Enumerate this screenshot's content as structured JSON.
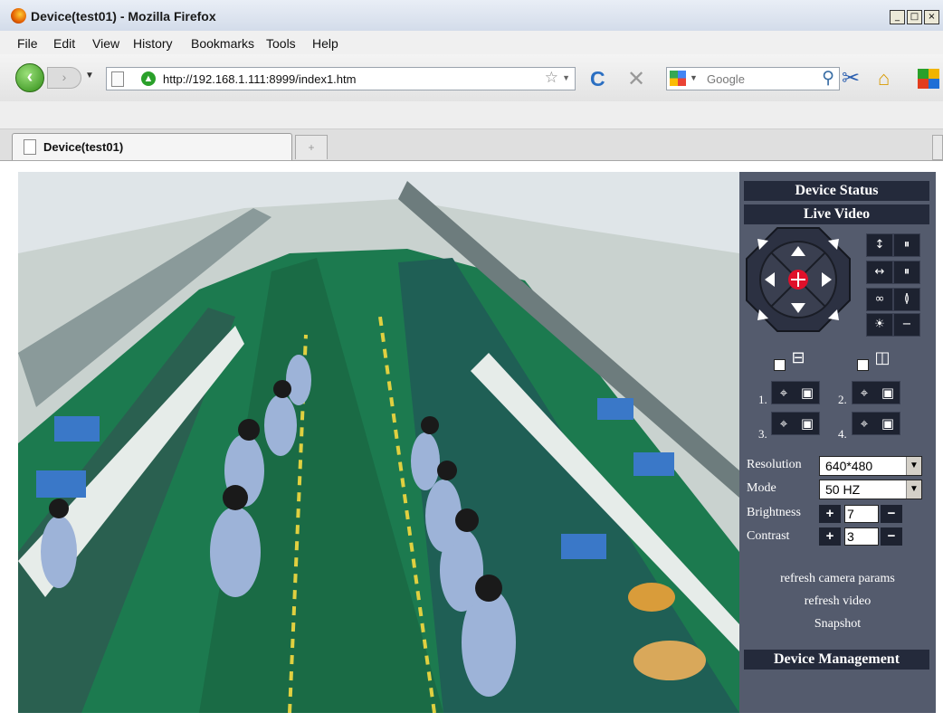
{
  "window": {
    "title": "Device(test01) - Mozilla Firefox",
    "controls": [
      "_",
      "□",
      "×"
    ]
  },
  "menu": [
    "File",
    "Edit",
    "View",
    "History",
    "Bookmarks",
    "Tools",
    "Help"
  ],
  "nav": {
    "url": "http://192.168.1.111:8999/index1.htm",
    "search_placeholder": "Google"
  },
  "tab": {
    "label": "Device(test01)"
  },
  "panel": {
    "device_status": "Device Status",
    "live_video": "Live Video",
    "preset_numbers": [
      "1.",
      "2.",
      "3.",
      "4."
    ],
    "resolution_label": "Resolution",
    "resolution_value": "640*480",
    "mode_label": "Mode",
    "mode_value": "50 HZ",
    "brightness_label": "Brightness",
    "brightness_value": "7",
    "contrast_label": "Contrast",
    "contrast_value": "3",
    "refresh_params": "refresh camera params",
    "refresh_video": "refresh video",
    "snapshot": "Snapshot",
    "device_management": "Device Management"
  }
}
